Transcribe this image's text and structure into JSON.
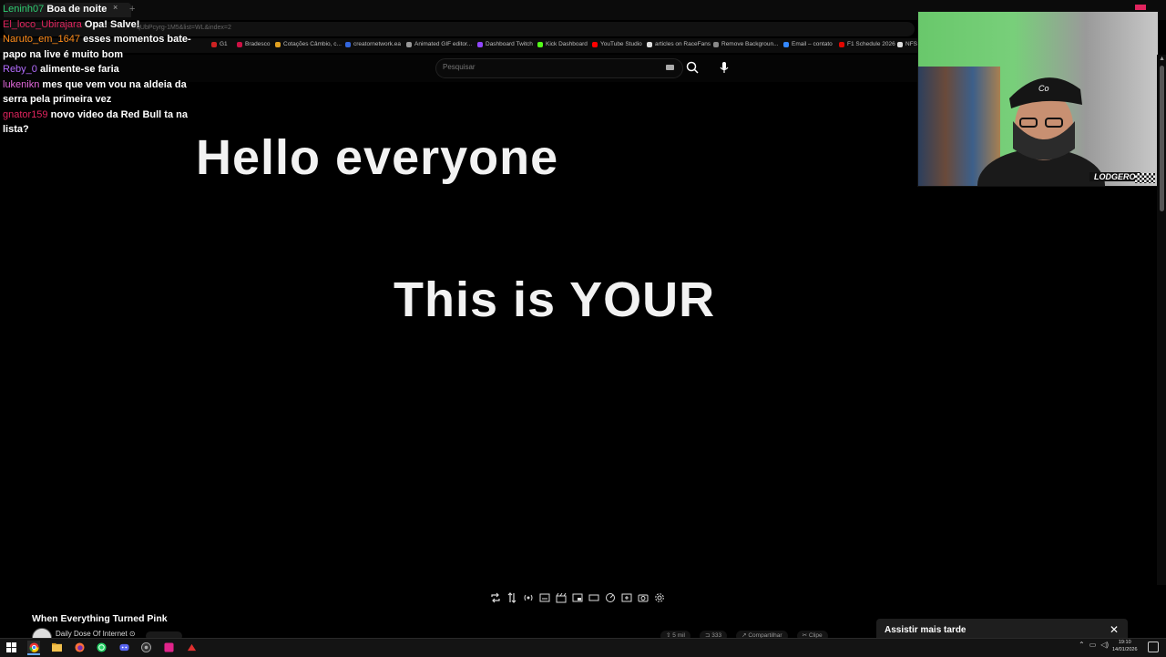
{
  "browser": {
    "tab_close": "×",
    "tab_add": "+",
    "url_fragment": "qUbPcyrg-1M5&list=WL&index=2",
    "bookmarks": [
      {
        "label": "G1",
        "color": "#cc2222"
      },
      {
        "label": "Bradesco",
        "color": "#cc1144"
      },
      {
        "label": "Cotações Câmbio, c...",
        "color": "#e0a020"
      },
      {
        "label": "creatornetwork.ea",
        "color": "#3366dd"
      },
      {
        "label": "Animated GIF editor...",
        "color": "#999999"
      },
      {
        "label": "Dashboard Twitch",
        "color": "#9146ff"
      },
      {
        "label": "Kick Dashboard",
        "color": "#53fc18"
      },
      {
        "label": "YouTube Studio",
        "color": "#ff0000"
      },
      {
        "label": "articles on RaceFans",
        "color": "#dddddd"
      },
      {
        "label": "Remove Backgroun...",
        "color": "#888888"
      },
      {
        "label": "Email – contato",
        "color": "#3388ff"
      },
      {
        "label": "F1 Schedule 2026",
        "color": "#e10600"
      },
      {
        "label": "NFS",
        "color": "#dddddd"
      }
    ]
  },
  "youtube": {
    "search_placeholder": "Pesquisar",
    "video_title": "When Everything Turned Pink",
    "channel_name": "Daily Dose Of Internet ⊙",
    "actions": [
      "⇧ 5 mil",
      "⊐ 333",
      "↗ Compartilhar",
      "✂ Clipe"
    ]
  },
  "video_frame": {
    "line1": "Hello everyone",
    "line2": "This is YOUR"
  },
  "chat": [
    {
      "user": "Leninh07",
      "color": "#2ecc71",
      "text": "Boa de noite"
    },
    {
      "user": "El_loco_Ubirajara",
      "color": "#e0245e",
      "text": "Opa! Salve!"
    },
    {
      "user": "Naruto_em_1647",
      "color": "#ff8c1a",
      "text": "esses momentos bate-papo na live é muito bom"
    },
    {
      "user": "Reby_0",
      "color": "#b46cff",
      "text": "alimente-se faria"
    },
    {
      "user": "lukenikn",
      "color": "#e66adf",
      "text": "mes que vem vou na aldeia da serra pela primeira vez"
    },
    {
      "user": "gnator159",
      "color": "#e0245e",
      "text": "novo video da Red Bull ta na lista?"
    }
  ],
  "webcam": {
    "overlay_logo": "LODGERO"
  },
  "toast": {
    "text": "Assistir mais tarde",
    "close": "✕"
  },
  "taskbar": {
    "time": "19:10",
    "date": "14/01/2026",
    "icons": [
      "windows-icon",
      "chrome-icon",
      "file-explorer-icon",
      "firefox-icon",
      "whatsapp-icon",
      "discord-icon",
      "obs-icon",
      "app-pink-icon",
      "app-red-icon"
    ]
  }
}
